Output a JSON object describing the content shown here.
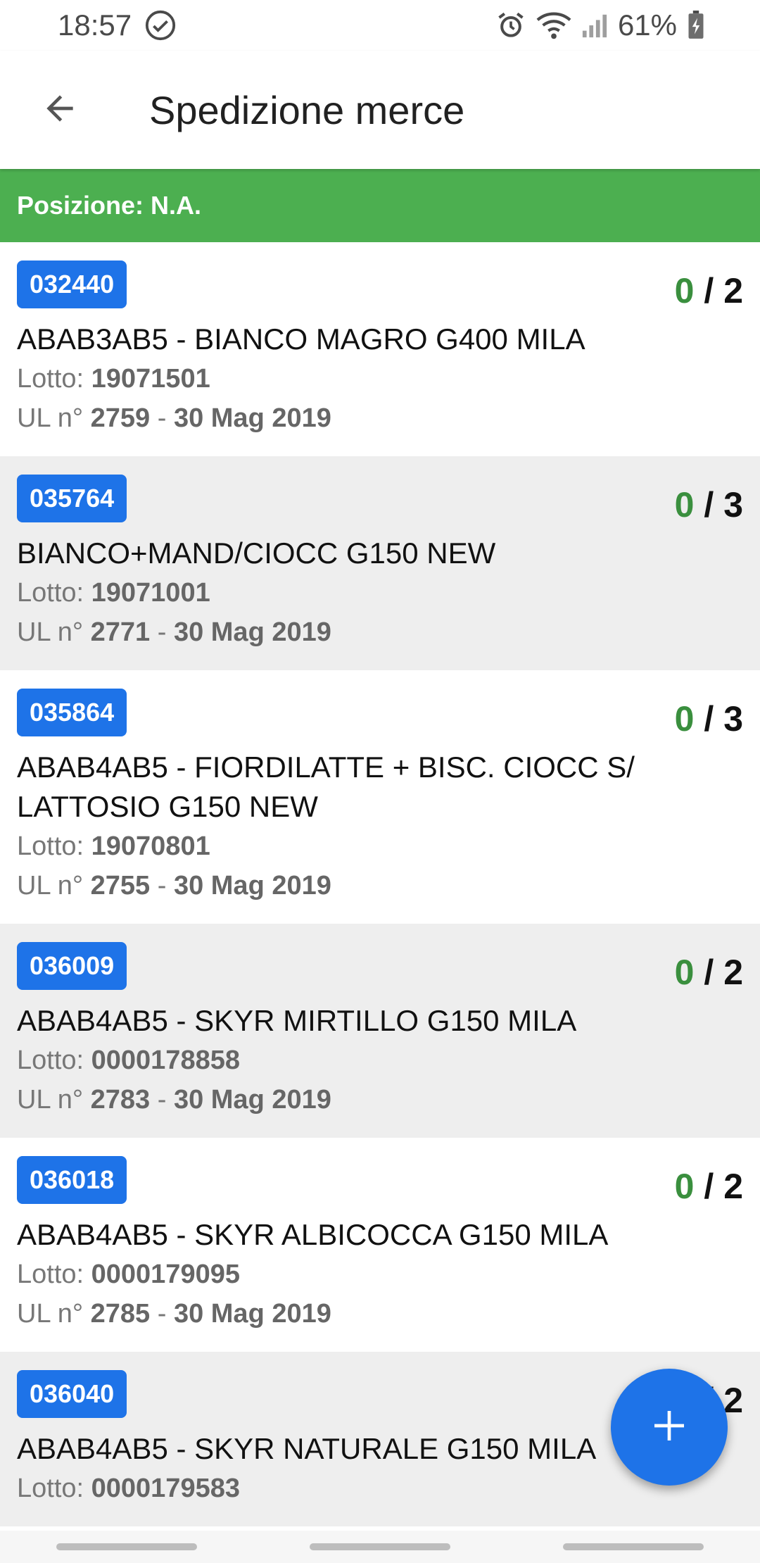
{
  "status": {
    "time": "18:57",
    "battery": "61%"
  },
  "header": {
    "title": "Spedizione merce"
  },
  "banner": {
    "position": "Posizione: N.A."
  },
  "labels": {
    "lot": "Lotto:",
    "ul": "UL n°",
    "sep": "-",
    "slash": "/"
  },
  "items": [
    {
      "code": "032440",
      "done": "0",
      "total": "2",
      "title": "ABAB3AB5 - BIANCO MAGRO G400 MILA",
      "lot": "19071501",
      "ul": "2759",
      "date": "30 Mag 2019"
    },
    {
      "code": "035764",
      "done": "0",
      "total": "3",
      "title": "BIANCO+MAND/CIOCC G150 NEW",
      "lot": "19071001",
      "ul": "2771",
      "date": "30 Mag 2019"
    },
    {
      "code": "035864",
      "done": "0",
      "total": "3",
      "title": "ABAB4AB5 - FIORDILATTE + BISC. CIOCC S/ LATTOSIO G150 NEW",
      "lot": "19070801",
      "ul": "2755",
      "date": "30 Mag 2019"
    },
    {
      "code": "036009",
      "done": "0",
      "total": "2",
      "title": "ABAB4AB5 - SKYR MIRTILLO G150 MILA",
      "lot": "0000178858",
      "ul": "2783",
      "date": "30 Mag 2019"
    },
    {
      "code": "036018",
      "done": "0",
      "total": "2",
      "title": "ABAB4AB5  - SKYR ALBICOCCA G150 MILA",
      "lot": "0000179095",
      "ul": "2785",
      "date": "30 Mag 2019"
    },
    {
      "code": "036040",
      "done": "0",
      "total": "2",
      "title": "ABAB4AB5 - SKYR NATURALE G150 MILA",
      "lot": "0000179583",
      "ul": "",
      "date": ""
    }
  ],
  "icons": {
    "back": "arrow-back-icon",
    "add": "plus-icon"
  },
  "colors": {
    "accent": "#1e73e8",
    "banner": "#4caf50",
    "done": "#3a8f3e"
  }
}
